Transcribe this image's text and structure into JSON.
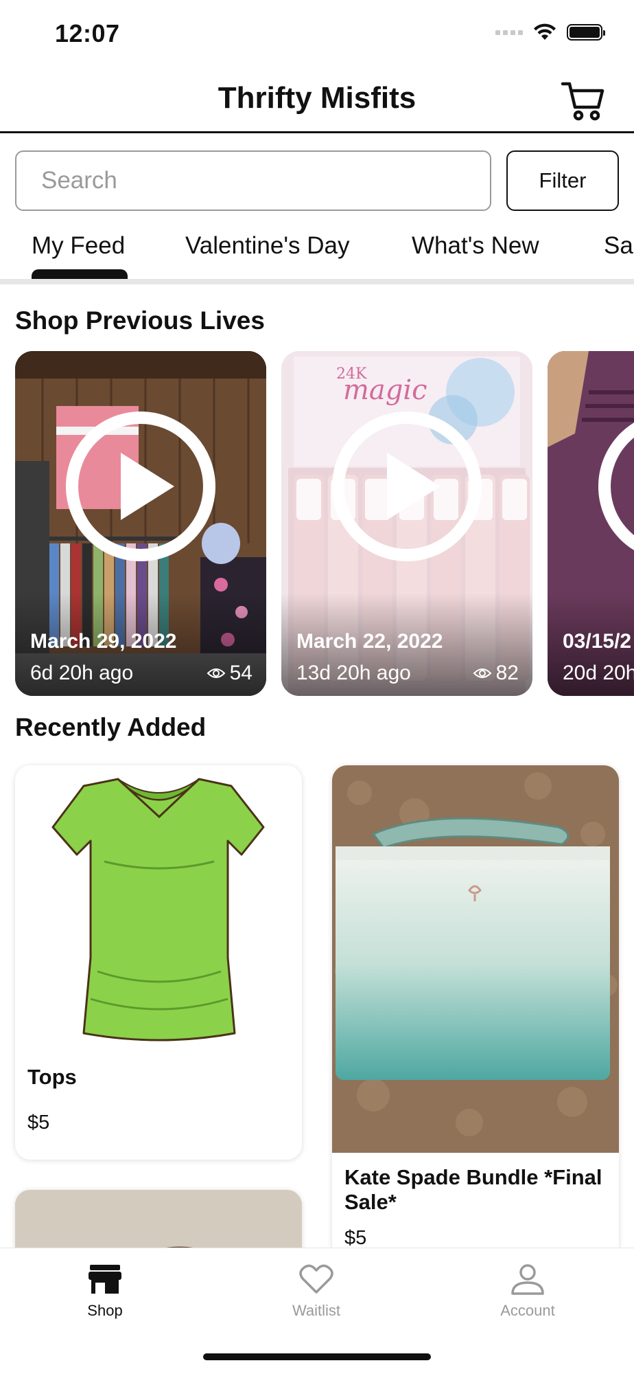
{
  "status_bar": {
    "time": "12:07",
    "icons": [
      "signal-icon",
      "wifi-icon",
      "battery-icon"
    ]
  },
  "header": {
    "title": "Thrifty Misfits",
    "cart_icon": "cart-icon"
  },
  "search": {
    "placeholder": "Search",
    "filter_label": "Filter"
  },
  "tabs": [
    {
      "label": "My Feed",
      "selected": true
    },
    {
      "label": "Valentine's Day",
      "selected": false
    },
    {
      "label": "What's New",
      "selected": false
    },
    {
      "label": "Sal",
      "selected": false
    }
  ],
  "previous_lives": {
    "title": "Shop Previous Lives",
    "items": [
      {
        "date": "March 29, 2022",
        "ago": "6d 20h ago",
        "views": "54"
      },
      {
        "date": "March 22, 2022",
        "ago": "13d 20h ago",
        "views": "82"
      },
      {
        "date": "03/15/2",
        "ago": "20d 20h",
        "views": ""
      }
    ]
  },
  "recently_added": {
    "title": "Recently Added",
    "items": [
      {
        "name": "Tops",
        "price": "$5"
      },
      {
        "name": "Kate Spade Bundle *Final Sale*",
        "price": "$5"
      }
    ]
  },
  "bottom_nav": {
    "items": [
      {
        "label": "Shop",
        "icon": "store-icon",
        "active": true
      },
      {
        "label": "Waitlist",
        "icon": "heart-icon",
        "active": false
      },
      {
        "label": "Account",
        "icon": "person-icon",
        "active": false
      }
    ]
  },
  "colors": {
    "primary": "#111111",
    "inactive": "#9a9a9a",
    "divider": "#e6e6e6",
    "tshirt_green": "#8cd14a"
  }
}
